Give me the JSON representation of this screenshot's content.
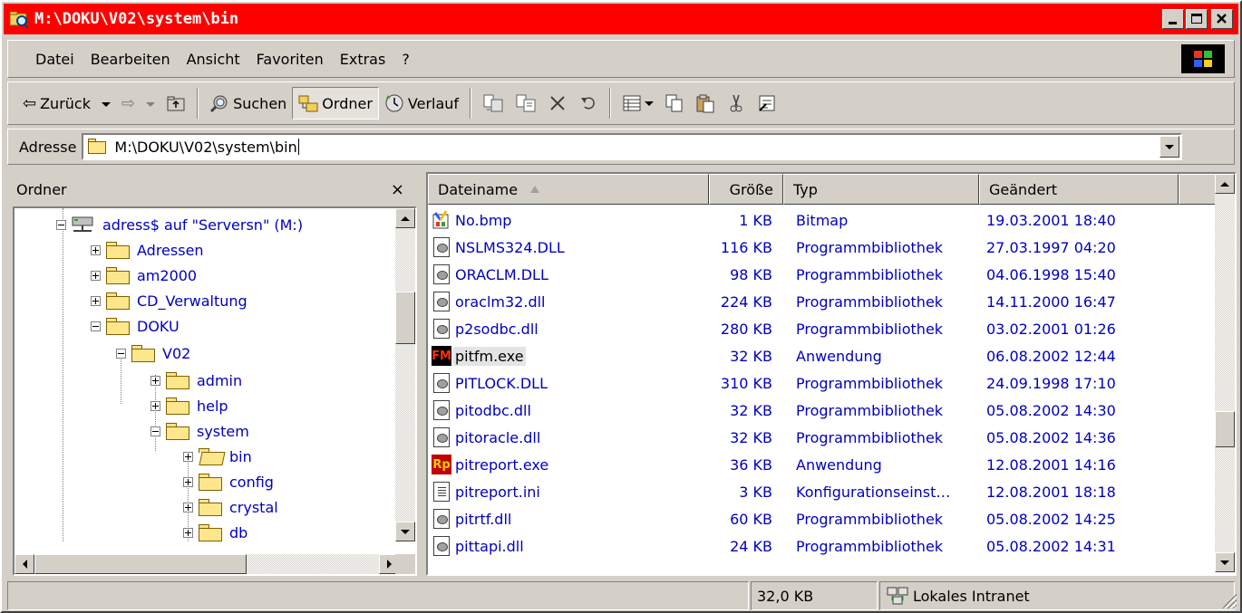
{
  "window": {
    "title": "M:\\DOKU\\V02\\system\\bin"
  },
  "menu": [
    "Datei",
    "Bearbeiten",
    "Ansicht",
    "Favoriten",
    "Extras",
    "?"
  ],
  "toolbar": {
    "back": "Zurück",
    "search": "Suchen",
    "folders": "Ordner",
    "history": "Verlauf"
  },
  "address": {
    "label": "Adresse",
    "value": "M:\\DOKU\\V02\\system\\bin"
  },
  "folders_pane": {
    "title": "Ordner",
    "close": "×",
    "tree": [
      {
        "label": "adress$ auf \"Serversn\" (M:)",
        "icon": "network-drive-icon",
        "expander": "minus"
      },
      {
        "label": "Adressen",
        "icon": "folder-icon",
        "expander": "plus"
      },
      {
        "label": "am2000",
        "icon": "folder-icon",
        "expander": "plus"
      },
      {
        "label": "CD_Verwaltung",
        "icon": "folder-icon",
        "expander": "plus"
      },
      {
        "label": "DOKU",
        "icon": "folder-icon",
        "expander": "minus"
      },
      {
        "label": "V02",
        "icon": "folder-icon",
        "expander": "minus"
      },
      {
        "label": "admin",
        "icon": "folder-icon",
        "expander": "plus"
      },
      {
        "label": "help",
        "icon": "folder-icon",
        "expander": "plus"
      },
      {
        "label": "system",
        "icon": "folder-icon",
        "expander": "minus"
      },
      {
        "label": "bin",
        "icon": "open-folder-icon",
        "expander": "plus"
      },
      {
        "label": "config",
        "icon": "folder-icon",
        "expander": "plus"
      },
      {
        "label": "crystal",
        "icon": "folder-icon",
        "expander": "plus"
      },
      {
        "label": "db",
        "icon": "folder-icon",
        "expander": "plus"
      }
    ]
  },
  "columns": {
    "name": "Dateiname",
    "size": "Größe",
    "type": "Typ",
    "modified": "Geändert"
  },
  "files": [
    {
      "name": "No.bmp",
      "size": "1 KB",
      "type": "Bitmap",
      "modified": "19.03.2001 18:40",
      "icon": "bitmap-icon"
    },
    {
      "name": "NSLMS324.DLL",
      "size": "116 KB",
      "type": "Programmbibliothek",
      "modified": "27.03.1997 04:20",
      "icon": "dll-icon"
    },
    {
      "name": "ORACLM.DLL",
      "size": "98 KB",
      "type": "Programmbibliothek",
      "modified": "04.06.1998 15:40",
      "icon": "dll-icon"
    },
    {
      "name": "oraclm32.dll",
      "size": "224 KB",
      "type": "Programmbibliothek",
      "modified": "14.11.2000 16:47",
      "icon": "dll-icon"
    },
    {
      "name": "p2sodbc.dll",
      "size": "280 KB",
      "type": "Programmbibliothek",
      "modified": "03.02.2001 01:26",
      "icon": "dll-icon"
    },
    {
      "name": "pitfm.exe",
      "size": "32 KB",
      "type": "Anwendung",
      "modified": "06.08.2002 12:44",
      "icon": "exe-fm-icon",
      "selected": true
    },
    {
      "name": "PITLOCK.DLL",
      "size": "310 KB",
      "type": "Programmbibliothek",
      "modified": "24.09.1998 17:10",
      "icon": "dll-icon"
    },
    {
      "name": "pitodbc.dll",
      "size": "32 KB",
      "type": "Programmbibliothek",
      "modified": "05.08.2002 14:30",
      "icon": "dll-icon"
    },
    {
      "name": "pitoracle.dll",
      "size": "32 KB",
      "type": "Programmbibliothek",
      "modified": "05.08.2002 14:36",
      "icon": "dll-icon"
    },
    {
      "name": "pitreport.exe",
      "size": "36 KB",
      "type": "Anwendung",
      "modified": "12.08.2001 14:16",
      "icon": "exe-rp-icon"
    },
    {
      "name": "pitreport.ini",
      "size": "3 KB",
      "type": "Konfigurationseinst…",
      "modified": "12.08.2001 18:18",
      "icon": "ini-icon"
    },
    {
      "name": "pitrtf.dll",
      "size": "60 KB",
      "type": "Programmbibliothek",
      "modified": "05.08.2002 14:25",
      "icon": "dll-icon"
    },
    {
      "name": "pittapi.dll",
      "size": "24 KB",
      "type": "Programmbibliothek",
      "modified": "05.08.2002 14:31",
      "icon": "dll-icon"
    }
  ],
  "exe_icon_text": {
    "fm": "FM",
    "rp": "Rp"
  },
  "status": {
    "size": "32,0 KB",
    "zone": "Lokales Intranet"
  },
  "colors": {
    "titlebar": "#ff0000",
    "link": "#0000c0",
    "face": "#d4d0c8"
  }
}
